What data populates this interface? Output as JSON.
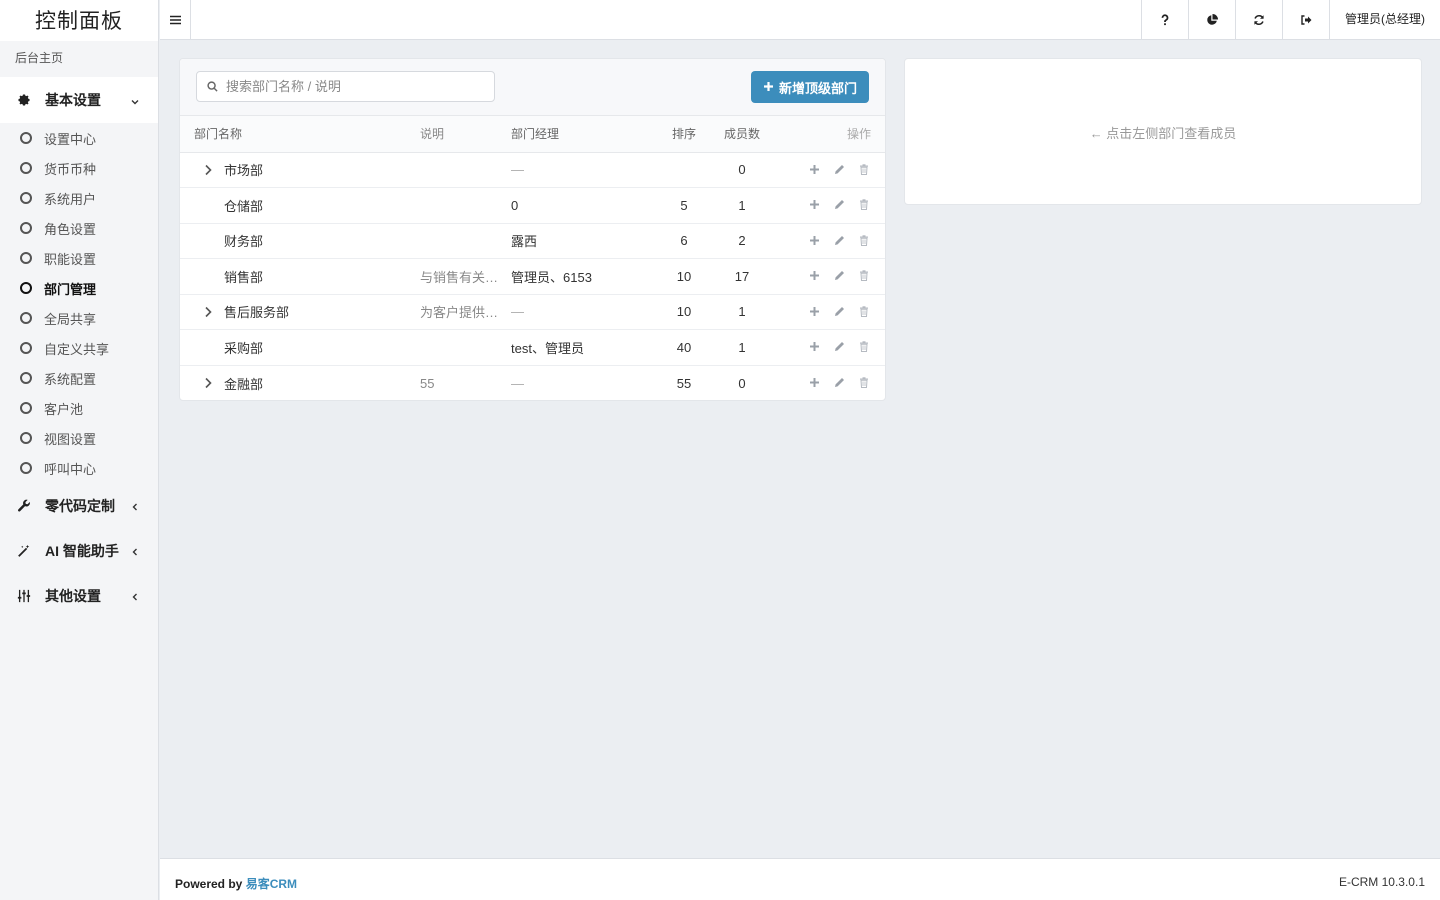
{
  "sidebar": {
    "title": "控制面板",
    "home": "后台主页",
    "groups": [
      {
        "label": "基本设置",
        "icon": "gear-icon",
        "expanded": true,
        "items": [
          {
            "label": "设置中心",
            "active": false
          },
          {
            "label": "货币币种",
            "active": false
          },
          {
            "label": "系统用户",
            "active": false
          },
          {
            "label": "角色设置",
            "active": false
          },
          {
            "label": "职能设置",
            "active": false
          },
          {
            "label": "部门管理",
            "active": true
          },
          {
            "label": "全局共享",
            "active": false
          },
          {
            "label": "自定义共享",
            "active": false
          },
          {
            "label": "系统配置",
            "active": false
          },
          {
            "label": "客户池",
            "active": false
          },
          {
            "label": "视图设置",
            "active": false
          },
          {
            "label": "呼叫中心",
            "active": false
          }
        ]
      },
      {
        "label": "零代码定制",
        "icon": "wrench-icon",
        "expanded": false
      },
      {
        "label": "AI 智能助手",
        "icon": "magic-wand-icon",
        "expanded": false
      },
      {
        "label": "其他设置",
        "icon": "sliders-icon",
        "expanded": false
      }
    ]
  },
  "topbar": {
    "user": "管理员(总经理)",
    "actions": [
      "help-icon",
      "pie-chart-icon",
      "refresh-icon",
      "logout-icon"
    ]
  },
  "dept": {
    "search_placeholder": "搜索部门名称 / 说明",
    "add_button": "新增顶级部门",
    "columns": {
      "name": "部门名称",
      "desc": "说明",
      "manager": "部门经理",
      "sort": "排序",
      "members": "成员数",
      "ops": "操作"
    },
    "rows": [
      {
        "name": "市场部",
        "expandable": true,
        "desc": "",
        "manager": "—",
        "sort": "",
        "members": "0"
      },
      {
        "name": "仓储部",
        "expandable": false,
        "desc": "",
        "manager": "0",
        "sort": "5",
        "members": "1"
      },
      {
        "name": "财务部",
        "expandable": false,
        "desc": "",
        "manager": "露西",
        "sort": "6",
        "members": "2"
      },
      {
        "name": "销售部",
        "expandable": false,
        "desc": "与销售有关…",
        "manager": "管理员、6153",
        "sort": "10",
        "members": "17"
      },
      {
        "name": "售后服务部",
        "expandable": true,
        "desc": "为客户提供…",
        "manager": "—",
        "sort": "10",
        "members": "1"
      },
      {
        "name": "采购部",
        "expandable": false,
        "desc": "",
        "manager": "test、管理员",
        "sort": "40",
        "members": "1"
      },
      {
        "name": "金融部",
        "expandable": true,
        "desc": "55",
        "manager": "—",
        "sort": "55",
        "members": "0"
      }
    ]
  },
  "members": {
    "hint": "← 点击左侧部门查看成员"
  },
  "footer": {
    "powered_prefix": "Powered by ",
    "powered_brand": "易客CRM",
    "version": "E-CRM 10.3.0.1"
  },
  "colors": {
    "accent": "#3c8dbc",
    "sidebar_bg": "#f4f5f7",
    "page_bg": "#ebeef2"
  }
}
